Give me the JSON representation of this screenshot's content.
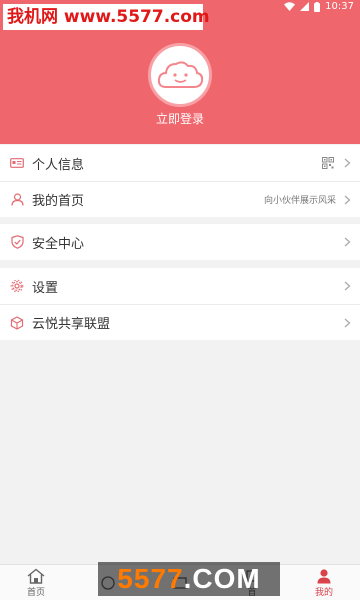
{
  "status_bar": {
    "time": "10:37"
  },
  "watermarks": {
    "top": "我机网 www.5577.com",
    "bottom_num": "5577",
    "bottom_com": ".COM"
  },
  "header": {
    "login_label": "立即登录"
  },
  "menu": {
    "group1": [
      {
        "label": "个人信息",
        "icon": "id-card-icon",
        "right": "qr-code-icon"
      },
      {
        "label": "我的首页",
        "icon": "user-icon",
        "hint": "向小伙伴展示风采"
      }
    ],
    "group2": [
      {
        "label": "安全中心",
        "icon": "shield-icon"
      }
    ],
    "group3": [
      {
        "label": "设置",
        "icon": "gear-icon"
      },
      {
        "label": "云悦共享联盟",
        "icon": "cube-icon"
      }
    ]
  },
  "bottom_nav": {
    "items": [
      {
        "label": "首页",
        "icon": "home-icon",
        "active": false
      },
      {
        "label": "",
        "icon": "tab2-icon",
        "active": false
      },
      {
        "label": "",
        "icon": "tab3-icon",
        "active": false
      },
      {
        "label": "首",
        "icon": "tab4-icon",
        "active": false
      },
      {
        "label": "我的",
        "icon": "profile-icon",
        "active": true
      }
    ]
  },
  "colors": {
    "accent": "#f0666d",
    "active": "#d9434c",
    "icon_pink": "#e36a72"
  }
}
